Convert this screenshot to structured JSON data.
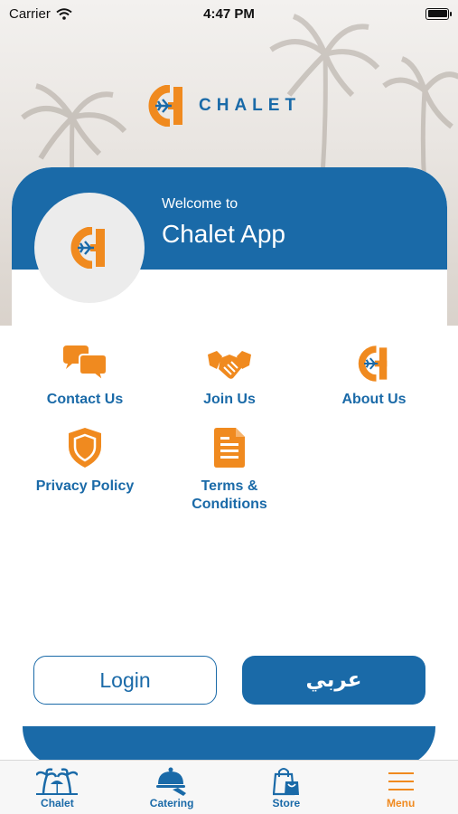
{
  "status_bar": {
    "carrier": "Carrier",
    "time": "4:47 PM"
  },
  "brand": {
    "name": "CHALET"
  },
  "header": {
    "welcome_small": "Welcome to",
    "welcome_big": "Chalet App"
  },
  "menu": {
    "items": [
      {
        "label": "Contact Us",
        "icon": "chat-bubbles-icon"
      },
      {
        "label": "Join Us",
        "icon": "handshake-icon"
      },
      {
        "label": "About Us",
        "icon": "chalet-logo-icon"
      },
      {
        "label": "Privacy Policy",
        "icon": "shield-icon"
      },
      {
        "label": "Terms & Conditions",
        "icon": "document-icon"
      }
    ]
  },
  "buttons": {
    "login": "Login",
    "language": "عربي"
  },
  "tabs": [
    {
      "label": "Chalet",
      "icon": "beach-icon"
    },
    {
      "label": "Catering",
      "icon": "cloche-icon"
    },
    {
      "label": "Store",
      "icon": "shopping-bag-icon"
    },
    {
      "label": "Menu",
      "icon": "hamburger-menu-icon",
      "active": true
    }
  ],
  "colors": {
    "primary": "#1a6aa8",
    "accent": "#f08a1f"
  }
}
